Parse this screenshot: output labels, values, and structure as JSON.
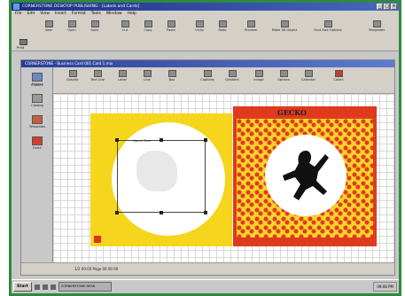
{
  "app": {
    "title": "CORNERSTONE DESKTOP PUBLISHING - [Labels and Cards]"
  },
  "menu": [
    "File",
    "Edit",
    "View",
    "Insert",
    "Format",
    "Tools",
    "Window",
    "Help"
  ],
  "toolbar1": {
    "buttons": [
      "New",
      "Open",
      "Save",
      "Cut",
      "Copy",
      "Paste",
      "Undo",
      "Redo",
      "Preview",
      "Make 3D Object",
      "Font Size Options",
      "Templates"
    ],
    "print_label": "Print"
  },
  "inner": {
    "title": "CORNERSTONE - Business Card 001 Card 1.mix",
    "side_buttons": [
      "Project",
      "Catalog",
      "Templates",
      "Extra"
    ],
    "toolbar": [
      "Graphic",
      "Text Line",
      "Label",
      "Line",
      "Box",
      "Captions",
      "Gradient",
      "Image",
      "Options",
      "Calendar",
      "Colors"
    ],
    "expand_label": "Expand"
  },
  "canvas": {
    "left_card_label": "Name Text",
    "right_card_title": "GECKO"
  },
  "status": {
    "text": "1/2    00:00    Page 00 00 00"
  },
  "taskbar": {
    "start": "Start",
    "task1": "CORNERSTONE DESK",
    "clock": "09:08 PM"
  }
}
